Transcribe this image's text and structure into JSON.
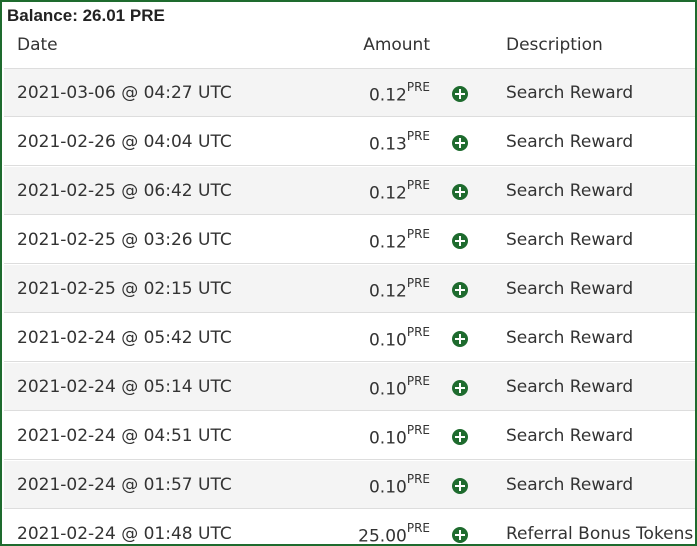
{
  "balance": "Balance: 26.01 PRE",
  "columns": {
    "date": "Date",
    "amount": "Amount",
    "description": "Description"
  },
  "colors": {
    "accent": "#1e6b2e"
  },
  "rows": [
    {
      "date": "2021-03-06 @ 04:27 UTC",
      "amount": "0.12",
      "unit": "PRE",
      "icon": "plus-circle-icon",
      "description": "Search Reward"
    },
    {
      "date": "2021-02-26 @ 04:04 UTC",
      "amount": "0.13",
      "unit": "PRE",
      "icon": "plus-circle-icon",
      "description": "Search Reward"
    },
    {
      "date": "2021-02-25 @ 06:42 UTC",
      "amount": "0.12",
      "unit": "PRE",
      "icon": "plus-circle-icon",
      "description": "Search Reward"
    },
    {
      "date": "2021-02-25 @ 03:26 UTC",
      "amount": "0.12",
      "unit": "PRE",
      "icon": "plus-circle-icon",
      "description": "Search Reward"
    },
    {
      "date": "2021-02-25 @ 02:15 UTC",
      "amount": "0.12",
      "unit": "PRE",
      "icon": "plus-circle-icon",
      "description": "Search Reward"
    },
    {
      "date": "2021-02-24 @ 05:42 UTC",
      "amount": "0.10",
      "unit": "PRE",
      "icon": "plus-circle-icon",
      "description": "Search Reward"
    },
    {
      "date": "2021-02-24 @ 05:14 UTC",
      "amount": "0.10",
      "unit": "PRE",
      "icon": "plus-circle-icon",
      "description": "Search Reward"
    },
    {
      "date": "2021-02-24 @ 04:51 UTC",
      "amount": "0.10",
      "unit": "PRE",
      "icon": "plus-circle-icon",
      "description": "Search Reward"
    },
    {
      "date": "2021-02-24 @ 01:57 UTC",
      "amount": "0.10",
      "unit": "PRE",
      "icon": "plus-circle-icon",
      "description": "Search Reward"
    },
    {
      "date": "2021-02-24 @ 01:48 UTC",
      "amount": "25.00",
      "unit": "PRE",
      "icon": "plus-circle-icon",
      "description": "Referral Bonus Tokens"
    }
  ]
}
